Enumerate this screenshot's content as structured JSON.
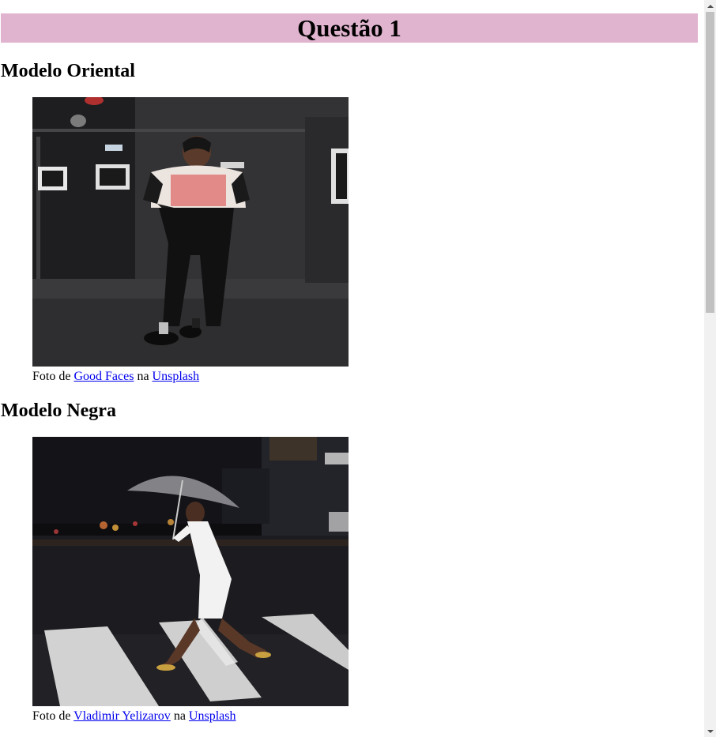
{
  "page": {
    "title": "Questão 1"
  },
  "sections": [
    {
      "heading": "Modelo Oriental",
      "image_alt": "Modelo Oriental",
      "caption_prefix": "Foto de ",
      "author": "Good Faces",
      "caption_middle": " na ",
      "source": "Unsplash"
    },
    {
      "heading": "Modelo Negra",
      "image_alt": "Modelo Negra",
      "caption_prefix": "Foto de ",
      "author": "Vladimir Yelizarov",
      "caption_middle": " na ",
      "source": "Unsplash"
    }
  ],
  "colors": {
    "title_bar_background": "#e0b3cf",
    "link": "#0000ee"
  }
}
